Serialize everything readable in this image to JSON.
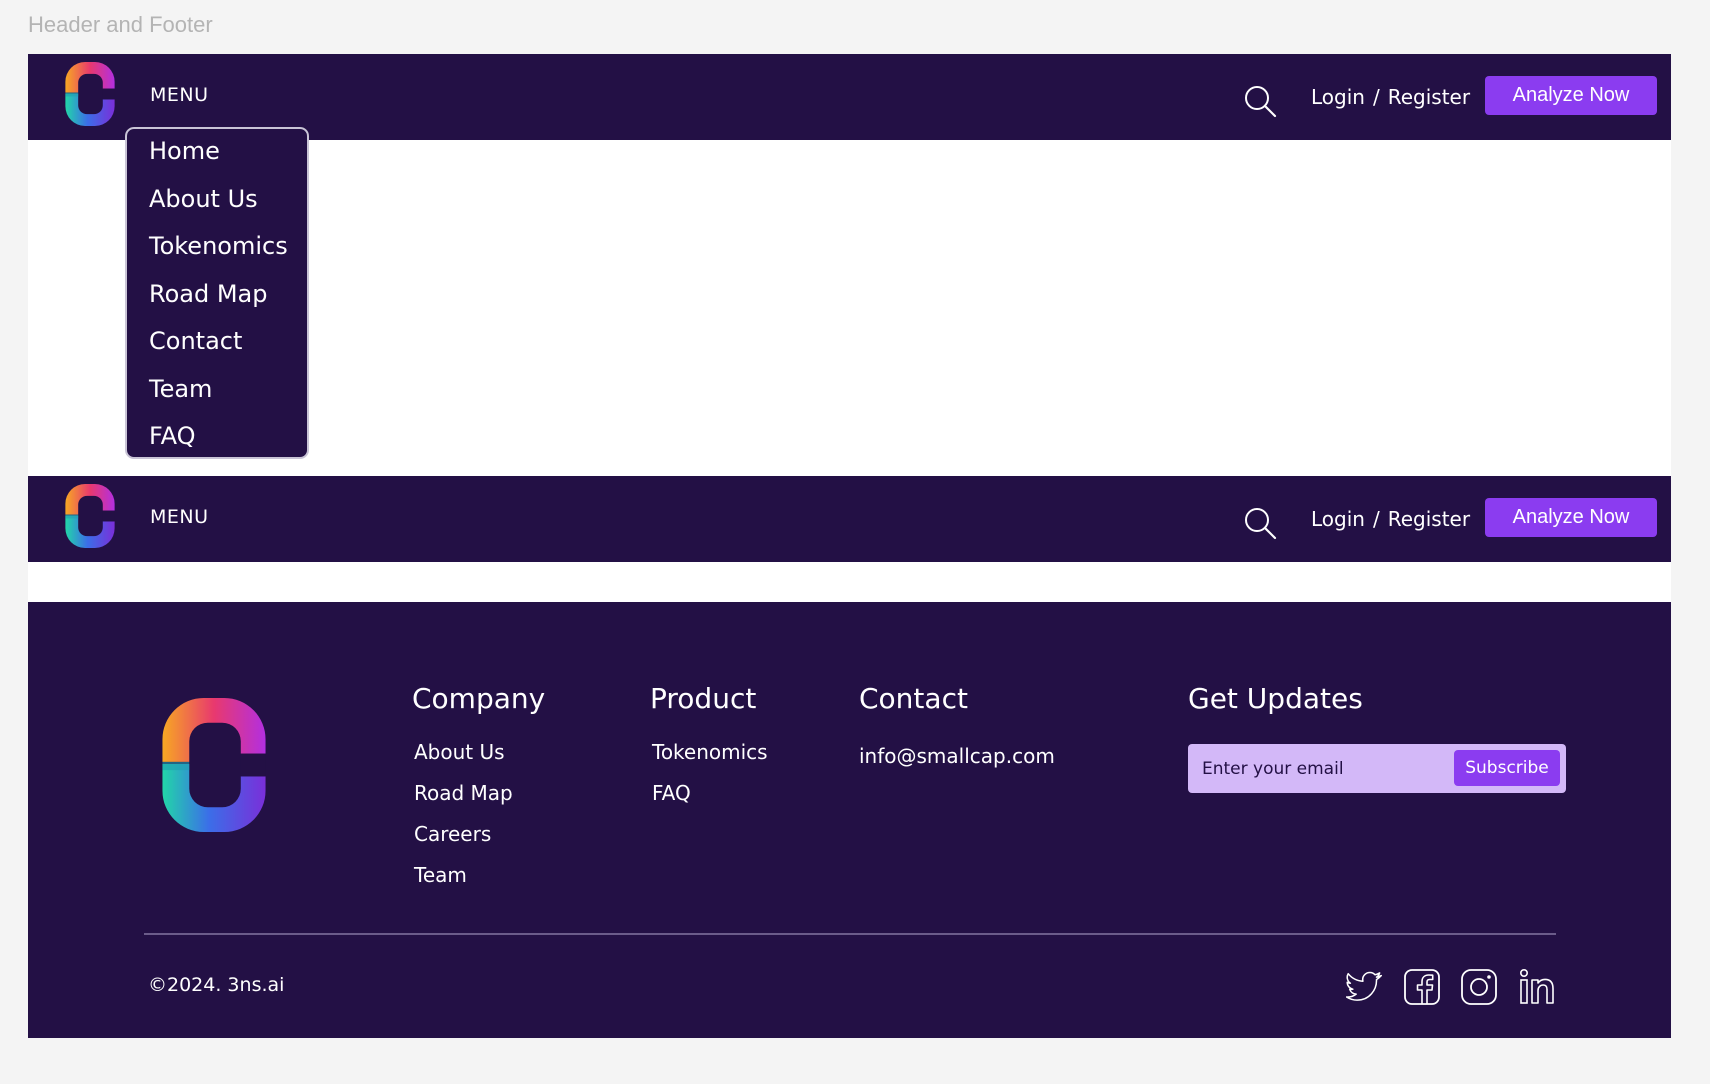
{
  "frame_label": "Header and Footer",
  "colors": {
    "navy": "#231045",
    "accent": "#8b3cf0",
    "input_bg": "#d3b8f8"
  },
  "header": {
    "menu_label": "MENU",
    "search_icon": "search-icon",
    "login_label": "Login",
    "separator": "/",
    "register_label": "Register",
    "cta_label": "Analyze Now"
  },
  "dropdown": {
    "items": [
      "Home",
      "About Us",
      "Tokenomics",
      "Road Map",
      "Contact",
      "Team",
      "FAQ"
    ]
  },
  "footer": {
    "company": {
      "heading": "Company",
      "links": [
        "About Us",
        "Road Map",
        "Careers",
        "Team"
      ]
    },
    "product": {
      "heading": "Product",
      "links": [
        "Tokenomics",
        "FAQ"
      ]
    },
    "contact": {
      "heading": "Contact",
      "email": "info@smallcap.com"
    },
    "updates": {
      "heading": "Get Updates",
      "placeholder": "Enter your email",
      "button": "Subscribe"
    },
    "copyright": "©2024. 3ns.ai",
    "social_icons": [
      "twitter-icon",
      "facebook-icon",
      "instagram-icon",
      "linkedin-icon"
    ]
  }
}
